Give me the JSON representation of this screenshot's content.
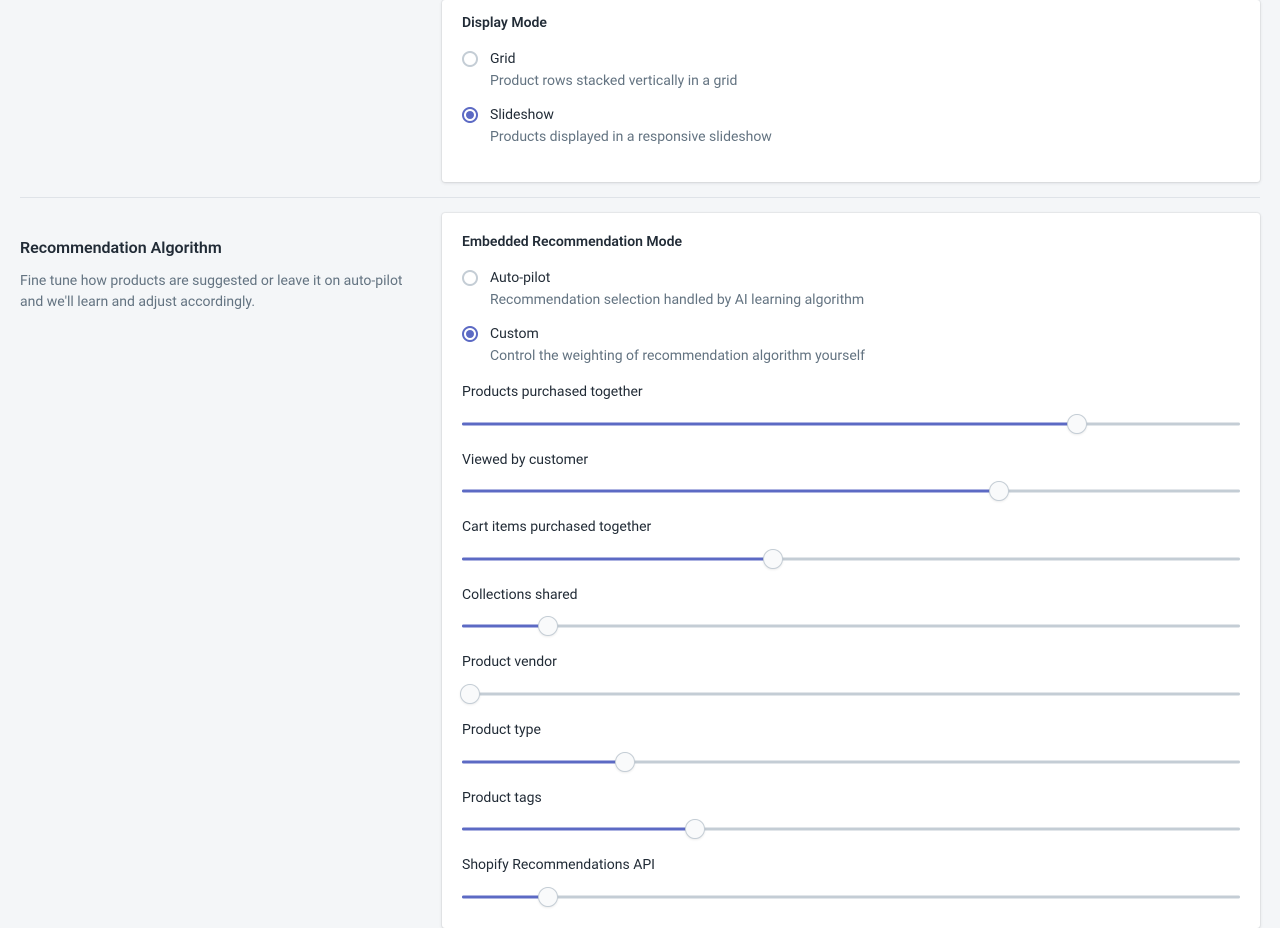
{
  "display_mode": {
    "title": "Display Mode",
    "options": [
      {
        "label": "Grid",
        "desc": "Product rows stacked vertically in a grid",
        "selected": false
      },
      {
        "label": "Slideshow",
        "desc": "Products displayed in a responsive slideshow",
        "selected": true
      }
    ]
  },
  "algorithm_section": {
    "title": "Recommendation Algorithm",
    "desc": "Fine tune how products are suggested or leave it on auto-pilot and we'll learn and adjust accordingly."
  },
  "embedded_mode": {
    "title": "Embedded Recommendation Mode",
    "options": [
      {
        "label": "Auto-pilot",
        "desc": "Recommendation selection handled by AI learning algorithm",
        "selected": false
      },
      {
        "label": "Custom",
        "desc": "Control the weighting of recommendation algorithm yourself",
        "selected": true
      }
    ]
  },
  "sliders": [
    {
      "label": "Products purchased together",
      "value": 79
    },
    {
      "label": "Viewed by customer",
      "value": 69
    },
    {
      "label": "Cart items purchased together",
      "value": 40
    },
    {
      "label": "Collections shared",
      "value": 11
    },
    {
      "label": "Product vendor",
      "value": 1
    },
    {
      "label": "Product type",
      "value": 21
    },
    {
      "label": "Product tags",
      "value": 30
    },
    {
      "label": "Shopify Recommendations API",
      "value": 11
    }
  ]
}
